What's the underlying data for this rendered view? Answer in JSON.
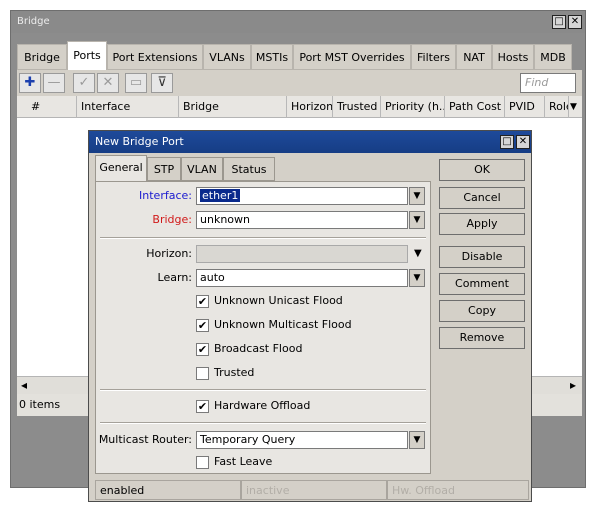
{
  "window": {
    "title": "Bridge",
    "restore_glyph": "□",
    "close_glyph": "✕"
  },
  "tabs": [
    "Bridge",
    "Ports",
    "Port Extensions",
    "VLANs",
    "MSTIs",
    "Port MST Overrides",
    "Filters",
    "NAT",
    "Hosts",
    "MDB"
  ],
  "active_tab": "Ports",
  "toolbar": {
    "icons": [
      "add-icon",
      "remove-icon",
      "enable-icon",
      "disable-icon",
      "comment-icon",
      "filter-icon"
    ],
    "glyphs": {
      "add": "✚",
      "remove": "—",
      "enable": "✓",
      "disable": "✕",
      "comment": "▭",
      "filter": "⊽"
    },
    "find_placeholder": "Find"
  },
  "table": {
    "columns": [
      "#",
      "Interface",
      "Bridge",
      "Horizon",
      "Trusted",
      "Priority (h...",
      "Path Cost",
      "PVID",
      "Role"
    ],
    "sort_glyph": "▼",
    "rows": [],
    "scroll_left": "◂",
    "scroll_right": "▸",
    "item_count": "0 items"
  },
  "dialog": {
    "title": "New Bridge Port",
    "tabs": [
      "General",
      "STP",
      "VLAN",
      "Status"
    ],
    "active_tab": "General",
    "fields": {
      "interface": {
        "label": "Interface:",
        "value": "ether1",
        "label_color": "#1a1ad0"
      },
      "bridge": {
        "label": "Bridge:",
        "value": "unknown",
        "label_color": "#d11a1a"
      },
      "horizon": {
        "label": "Horizon:",
        "value": ""
      },
      "learn": {
        "label": "Learn:",
        "value": "auto"
      },
      "multicast_router": {
        "label": "Multicast Router:",
        "value": "Temporary Query"
      }
    },
    "dropdown_glyph": "▼",
    "check_glyph": "✔",
    "checkboxes": {
      "unknown_unicast_flood": {
        "label": "Unknown Unicast Flood",
        "checked": true
      },
      "unknown_multicast_flood": {
        "label": "Unknown Multicast Flood",
        "checked": true
      },
      "broadcast_flood": {
        "label": "Broadcast Flood",
        "checked": true
      },
      "trusted": {
        "label": "Trusted",
        "checked": false
      },
      "hardware_offload": {
        "label": "Hardware Offload",
        "checked": true
      },
      "fast_leave": {
        "label": "Fast Leave",
        "checked": false
      }
    },
    "buttons": [
      "OK",
      "Cancel",
      "Apply",
      "Disable",
      "Comment",
      "Copy",
      "Remove"
    ],
    "status": [
      "enabled",
      "inactive",
      "Hw. Offload"
    ]
  }
}
